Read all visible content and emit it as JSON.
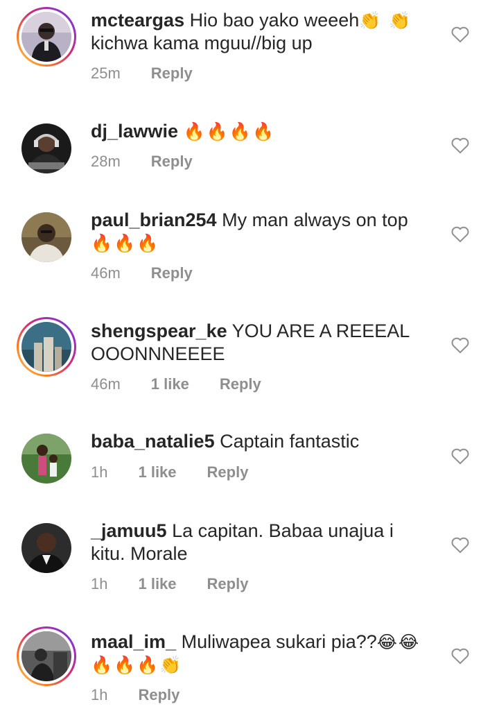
{
  "comments": [
    {
      "username": "mcteargas",
      "text": "Hio bao yako weeeh",
      "emoji1": "👏 👏",
      "line2": "kichwa kama mguu//big up",
      "emoji2": "",
      "time": "25m",
      "likes": "",
      "reply": "Reply",
      "avatar": "man-sunglasses",
      "story_ring": true
    },
    {
      "username": "dj_lawwie",
      "text": "",
      "emoji1": "🔥🔥🔥🔥",
      "line2": "",
      "emoji2": "",
      "time": "28m",
      "likes": "",
      "reply": "Reply",
      "avatar": "dj-headphones",
      "story_ring": false
    },
    {
      "username": "paul_brian254",
      "text": "My man always on top",
      "emoji1": "",
      "line2": "",
      "emoji2": "🔥🔥🔥",
      "time": "46m",
      "likes": "",
      "reply": "Reply",
      "avatar": "man-portrait",
      "story_ring": false
    },
    {
      "username": "shengspear_ke",
      "text": "YOU ARE A REEEAL",
      "emoji1": "",
      "line2": "OOONNNEEEE",
      "emoji2": "",
      "time": "46m",
      "likes": "1 like",
      "reply": "Reply",
      "avatar": "city-sky",
      "story_ring": true
    },
    {
      "username": "baba_natalie5",
      "text": "Captain fantastic",
      "emoji1": "",
      "line2": "",
      "emoji2": "",
      "time": "1h",
      "likes": "1 like",
      "reply": "Reply",
      "avatar": "family-outdoor",
      "story_ring": false
    },
    {
      "username": "_jamuu5",
      "text": "La capitan. Babaa unajua i",
      "emoji1": "",
      "line2": "kitu. Morale",
      "emoji2": "",
      "time": "1h",
      "likes": "1 like",
      "reply": "Reply",
      "avatar": "man-suit",
      "story_ring": false
    },
    {
      "username": "maal_im_",
      "text": "Muliwapea sukari pia??",
      "emoji1": "😂😂",
      "line2": "",
      "emoji2": "🔥🔥🔥👏",
      "time": "1h",
      "likes": "",
      "reply": "Reply",
      "avatar": "bw-photo",
      "story_ring": true
    }
  ],
  "icons": {
    "like": "heart-outline-icon"
  },
  "colors": {
    "text": "#262626",
    "muted": "#8e8e8e",
    "background": "#ffffff"
  }
}
